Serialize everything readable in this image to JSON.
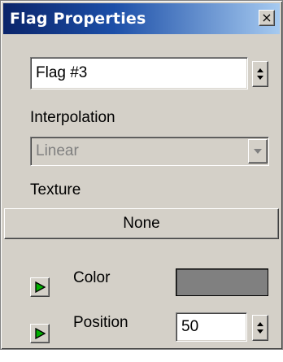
{
  "dialog": {
    "title": "Flag Properties",
    "close_glyph": "×",
    "close_icon": "close-icon"
  },
  "flag_name": {
    "value": "Flag #3",
    "spinner_icon": "spinner-up-down-icon"
  },
  "interpolation": {
    "label": "Interpolation",
    "selected": "Linear",
    "enabled": false,
    "dropdown_icon": "chevron-down-icon"
  },
  "texture": {
    "label": "Texture",
    "button_label": "None"
  },
  "color": {
    "label": "Color",
    "swatch_color": "#808080",
    "anim_icon": "animate-play-icon"
  },
  "position": {
    "label": "Position",
    "value": "50",
    "anim_icon": "animate-play-icon",
    "spinner_icon": "spinner-up-down-icon"
  },
  "colors": {
    "panel": "#d4d0c8",
    "title_start": "#0a246a",
    "title_end": "#a6caf0",
    "anim_icon_fill": "#00b000"
  }
}
